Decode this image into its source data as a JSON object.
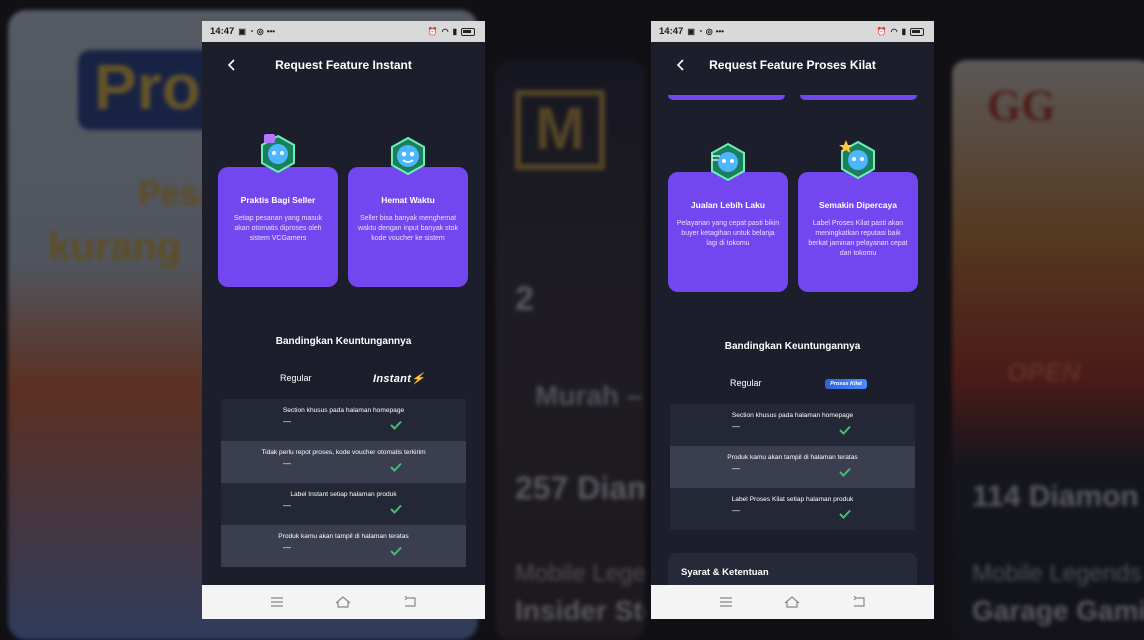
{
  "status_bar": {
    "time": "14:47"
  },
  "left_phone": {
    "title": "Request Feature Instant",
    "cards": [
      {
        "title": "Praktis Bagi Seller",
        "desc": "Setiap pesanan yang masuk akan otomatis diproses oleh sistem VCGamers"
      },
      {
        "title": "Hemat Waktu",
        "desc": "Seller bisa banyak menghemat waktu dengan input banyak stok kode voucher ke sistem"
      }
    ],
    "compare_title": "Bandingkan Keuntungannya",
    "col_regular": "Regular",
    "col_feature_logo": "Instant",
    "rows": [
      {
        "label": "Section khusus pada halaman homepage",
        "regular": "—"
      },
      {
        "label": "Tidak perlu repot proses, kode voucher otomatis terkirim",
        "regular": "—"
      },
      {
        "label": "Label Instant setiap halaman produk",
        "regular": "—"
      },
      {
        "label": "Produk kamu akan tampil di halaman teratas",
        "regular": "—"
      }
    ]
  },
  "right_phone": {
    "title": "Request Feature Proses Kilat",
    "cards": [
      {
        "title": "Jualan Lebih Laku",
        "desc": "Pelayanan yang cepat pasti bikin buyer ketagihan untuk belanja lagi di tokomu"
      },
      {
        "title": "Semakin Dipercaya",
        "desc": "Label Proses Kilat pasti akan meningkatkan reputasi baik berkat jaminan pelayanan cepat dari tokomu"
      }
    ],
    "compare_title": "Bandingkan Keuntungannya",
    "col_regular": "Regular",
    "col_feature_logo": "Proses Kilat",
    "rows": [
      {
        "label": "Section khusus pada halaman homepage",
        "regular": "—"
      },
      {
        "label": "Produk kamu akan tampil di halaman teratas",
        "regular": "—"
      },
      {
        "label": "Label Proses Kilat setiap halaman produk",
        "regular": "—"
      }
    ],
    "syarat_label": "Syarat & Ketentuan"
  },
  "background": {
    "left_big": "Pro",
    "left_line1": "Pesa",
    "left_line2": "kurang",
    "mid_price": "2",
    "mid_line": "Murah –",
    "mid_title": "257 Diam",
    "mid_game": "Mobile Lege",
    "mid_store": "Insider Sto",
    "right_logo": "GG",
    "right_open": "OPEN",
    "right_title": "114 Diamon",
    "right_game": "Mobile Legends",
    "right_store": "Garage Gami"
  },
  "colors": {
    "accent": "#7347f0",
    "check": "#39c46a",
    "phone_bg": "#1c1f2b"
  }
}
